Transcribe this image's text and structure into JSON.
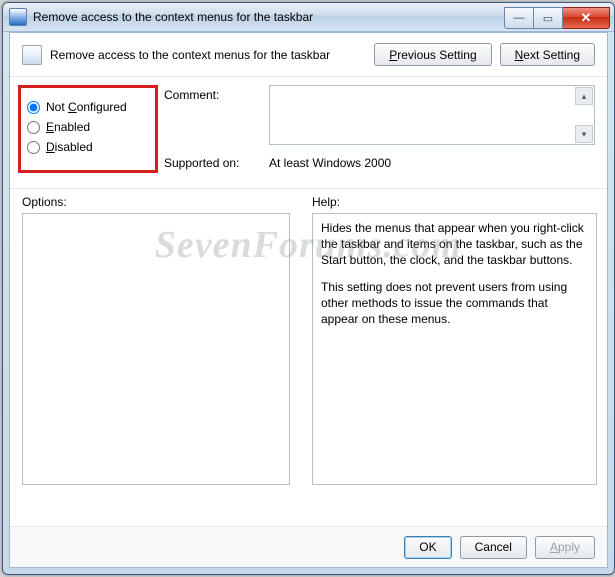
{
  "window": {
    "title": "Remove access to the context menus for the taskbar"
  },
  "header": {
    "policy_title": "Remove access to the context menus for the taskbar",
    "prev_button_pre": "",
    "prev_button_accel": "P",
    "prev_button_post": "revious Setting",
    "next_button_pre": "",
    "next_button_accel": "N",
    "next_button_post": "ext Setting"
  },
  "state": {
    "not_configured_pre": "Not ",
    "not_configured_accel": "C",
    "not_configured_post": "onfigured",
    "enabled_accel": "E",
    "enabled_post": "nabled",
    "disabled_accel": "D",
    "disabled_post": "isabled",
    "selected": "not_configured"
  },
  "fields": {
    "comment_label": "Comment:",
    "comment_value": "",
    "supported_label": "Supported on:",
    "supported_value": "At least Windows 2000"
  },
  "panels": {
    "options_label": "Options:",
    "options_content": "",
    "help_label": "Help:",
    "help_p1": "Hides the menus that appear when you right-click the taskbar and items on the taskbar, such as the Start button, the clock, and the taskbar buttons.",
    "help_p2": "This setting does not prevent users from using other methods to issue the commands that appear on these menus."
  },
  "footer": {
    "ok": "OK",
    "cancel": "Cancel",
    "apply_accel": "A",
    "apply_post": "pply"
  },
  "watermark": "SevenForums.com"
}
